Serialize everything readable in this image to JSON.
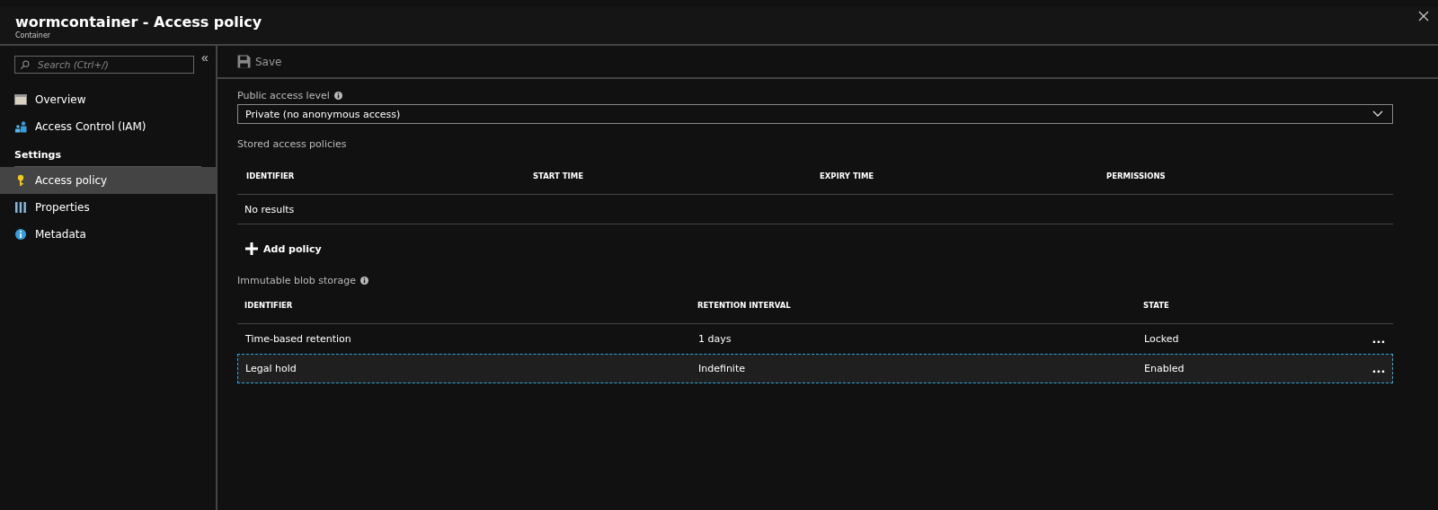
{
  "window": {
    "title": "wormcontainer - Access policy",
    "subtitle": "Container"
  },
  "sidebar": {
    "search": {
      "placeholder": "Search (Ctrl+/)"
    },
    "collapse_icon": "«",
    "items": [
      {
        "label": "Overview",
        "kind": "overview",
        "selected": false
      },
      {
        "label": "Access Control (IAM)",
        "kind": "iam",
        "selected": false
      }
    ],
    "section": "Settings",
    "settings_items": [
      {
        "label": "Access policy",
        "kind": "key",
        "selected": true
      },
      {
        "label": "Properties",
        "kind": "bars",
        "selected": false
      },
      {
        "label": "Metadata",
        "kind": "info",
        "selected": false
      }
    ]
  },
  "toolbar": {
    "save": {
      "label": "Save",
      "disabled": true
    }
  },
  "public_access": {
    "label": "Public access level",
    "value": "Private (no anonymous access)"
  },
  "stored_policies": {
    "title": "Stored access policies",
    "columns": [
      "IDENTIFIER",
      "START TIME",
      "EXPIRY TIME",
      "PERMISSIONS"
    ],
    "empty_text": "No results",
    "add_button": "Add policy"
  },
  "immutable": {
    "title": "Immutable blob storage",
    "columns": [
      "IDENTIFIER",
      "RETENTION INTERVAL",
      "STATE"
    ],
    "rows": [
      {
        "identifier": "Time-based retention",
        "interval": "1 days",
        "state": "Locked",
        "more": "...",
        "selected": false
      },
      {
        "identifier": "Legal hold",
        "interval": "Indefinite",
        "state": "Enabled",
        "more": "...",
        "selected": true
      }
    ]
  }
}
